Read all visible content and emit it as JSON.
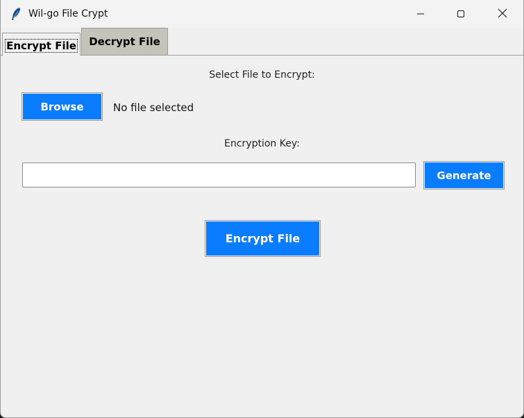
{
  "window": {
    "title": "Wil-go File Crypt",
    "icon": "feather-icon",
    "controls": [
      "minimize-icon",
      "maximize-icon",
      "close-icon"
    ]
  },
  "tabs": [
    {
      "label": "Encrypt File",
      "selected": true
    },
    {
      "label": "Decrypt File",
      "selected": false
    }
  ],
  "encrypt": {
    "select_label": "Select File to Encrypt:",
    "browse_label": "Browse",
    "file_status": "No file selected",
    "key_label": "Encryption Key:",
    "key_value": "",
    "generate_label": "Generate",
    "encrypt_label": "Encrypt File"
  },
  "colors": {
    "accent": "#0a7cff",
    "inactive_tab": "#c6c3bb",
    "window_bg": "#f0f0f0"
  }
}
